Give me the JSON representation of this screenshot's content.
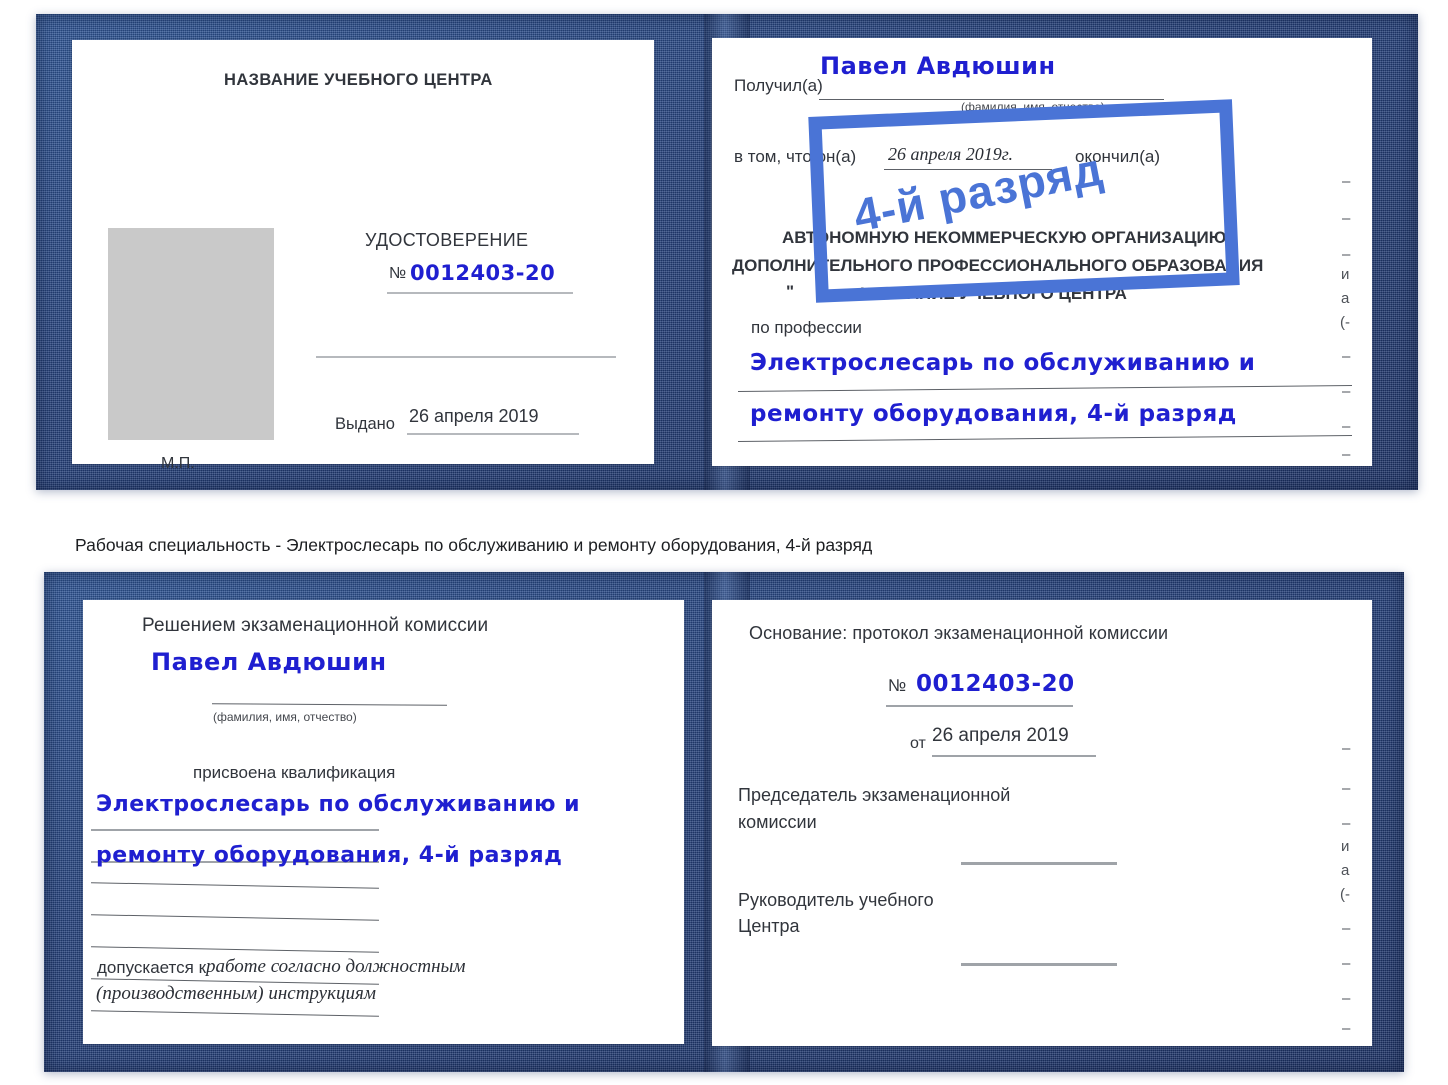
{
  "caption": {
    "text": "Рабочая специальность - Электрослесарь по обслуживанию и ремонту оборудования, 4-й разряд"
  },
  "colors": {
    "cover_blue": "#25417c",
    "ink_blue": "#1f1fd0",
    "stamp_blue": "#4a74d6",
    "photo_gray": "#c9c9c9",
    "rule_gray": "#b6b9bd"
  },
  "certificate_top": {
    "left_page": {
      "org_title": "НАЗВАНИЕ УЧЕБНОГО ЦЕНТРА",
      "doc_title": "УДОСТОВЕРЕНИЕ",
      "number_symbol": "№",
      "number_value": "0012403-20",
      "issued_label": "Выдано",
      "issued_value": "26 апреля 2019",
      "seal_label": "М.П.",
      "photo_placeholder": "photo-placeholder"
    },
    "right_page": {
      "received_label": "Получил(а)",
      "received_value": "Павел Авдюшин",
      "fio_hint": "(фамилия, имя, отчество)",
      "in_that_label": "в том, что он(а)",
      "completion_date": "26 апреля 2019г.",
      "finished_label": "окончил(а)",
      "org_line1": "АВТОНОМНУЮ НЕКОММЕРЧЕСКУЮ ОРГАНИЗАЦИЮ",
      "org_line2": "ДОПОЛНИТЕЛЬНОГО ПРОФЕССИОНАЛЬНОГО ОБРАЗОВАНИЯ",
      "org_quote_open": "\"",
      "org_line3": "НАЗВАНИЕ УЧЕБНОГО ЦЕНТРА",
      "org_quote_close": "\"",
      "profession_label": "по профессии",
      "profession_line1": "Электрослесарь по обслуживанию и",
      "profession_line2": "ремонту оборудования, 4-й разряд",
      "stamp_text": "4-й разряд",
      "edge_marks": [
        "–",
        "–",
        "–",
        "и",
        "а",
        "(-",
        "–",
        "–",
        "–",
        "–"
      ]
    }
  },
  "certificate_bottom": {
    "left_page": {
      "heading": "Решением экзаменационной комиссии",
      "name_value": "Павел Авдюшин",
      "fio_hint": "(фамилия, имя, отчество)",
      "qualification_label": "присвоена квалификация",
      "qualification_line1": "Электрослесарь по обслуживанию и",
      "qualification_line2": "ремонту оборудования, 4-й разряд",
      "admitted_label": "допускается к",
      "admitted_line1": "работе согласно должностным",
      "admitted_line2": "(производственным) инструкциям"
    },
    "right_page": {
      "basis_label": "Основание: протокол экзаменационной комиссии",
      "number_symbol": "№",
      "number_value": "0012403-20",
      "date_label": "от",
      "date_value": "26 апреля 2019",
      "chairman_line1": "Председатель экзаменационной",
      "chairman_line2": "комиссии",
      "director_line1": "Руководитель учебного",
      "director_line2": "Центра",
      "edge_marks": [
        "–",
        "–",
        "–",
        "и",
        "а",
        "(-",
        "–",
        "–",
        "–",
        "–"
      ]
    }
  }
}
